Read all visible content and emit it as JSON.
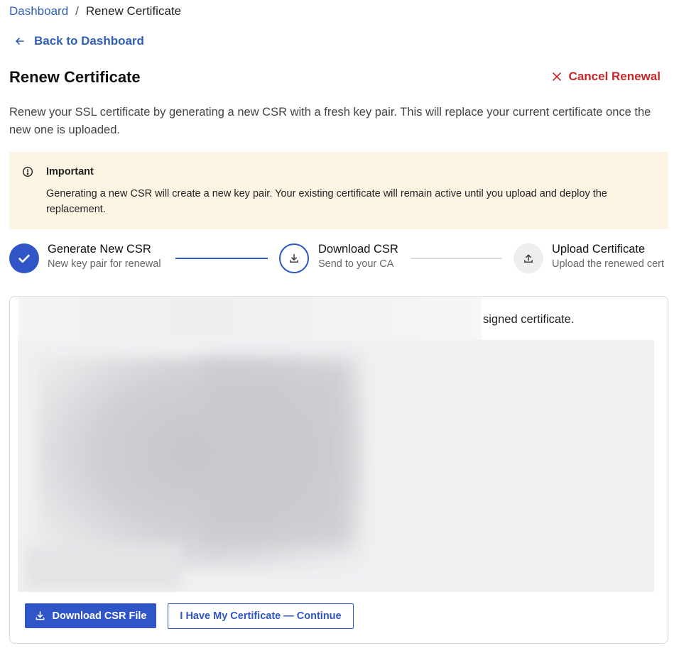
{
  "breadcrumb": {
    "home": "Dashboard",
    "separator": "/",
    "current": "Renew Certificate"
  },
  "back_link": {
    "label": "Back to Dashboard",
    "icon": "arrow-left-icon"
  },
  "header": {
    "title": "Renew Certificate",
    "cancel_label": "Cancel Renewal",
    "cancel_icon": "close-icon"
  },
  "intro": "Renew your SSL certificate by generating a new CSR with a fresh key pair. This will replace your current certificate once the new one is uploaded.",
  "alert": {
    "icon": "alert-circle-icon",
    "title": "Important",
    "body": "Generating a new CSR will create a new key pair. Your existing certificate will remain active until you upload and deploy the replacement."
  },
  "steps": [
    {
      "title": "Generate New CSR",
      "subtitle": "New key pair for renewal",
      "state": "done",
      "icon": "check-icon"
    },
    {
      "title": "Download CSR",
      "subtitle": "Send to your CA",
      "state": "active",
      "icon": "download-icon"
    },
    {
      "title": "Upload Certificate",
      "subtitle": "Upload the renewed cert",
      "state": "pending",
      "icon": "upload-icon"
    }
  ],
  "card": {
    "description_visible": "signed certificate.",
    "download_button": "Download CSR File",
    "continue_button": "I Have My Certificate — Continue"
  },
  "colors": {
    "accent": "#2f55c7",
    "link": "#2f5fb8",
    "danger": "#c62828",
    "alert_bg": "#fdf5e4"
  }
}
